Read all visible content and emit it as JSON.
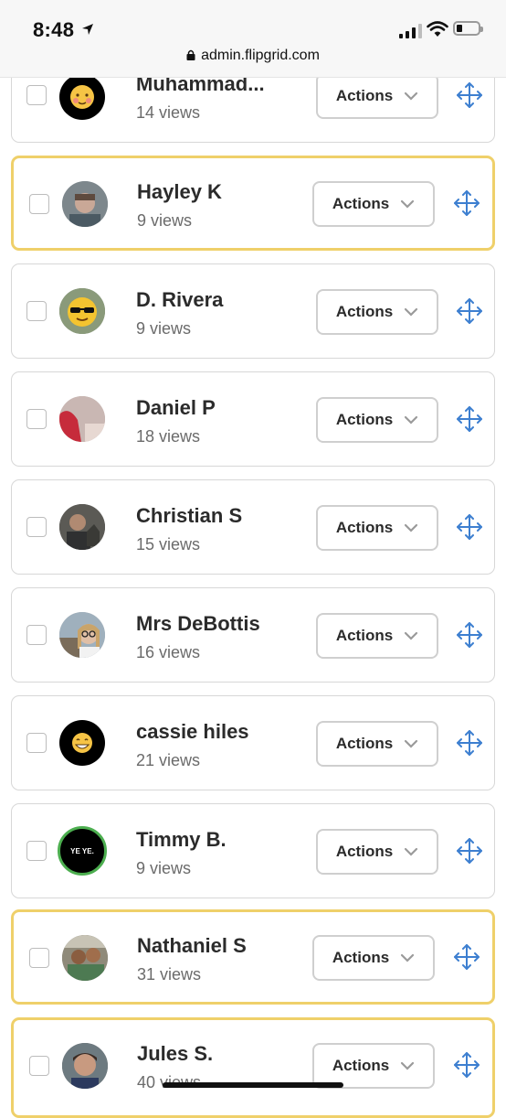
{
  "status_bar": {
    "time": "8:48",
    "url": "admin.flipgrid.com"
  },
  "action_label": "Actions",
  "responses": [
    {
      "name": "Muhammad...",
      "views": "14 views",
      "highlighted": false,
      "avatar": "emoji-cheeks"
    },
    {
      "name": "Hayley K",
      "views": "9 views",
      "highlighted": true,
      "avatar": "photo-gray"
    },
    {
      "name": "D. Rivera",
      "views": "9 views",
      "highlighted": false,
      "avatar": "emoji-sunglasses"
    },
    {
      "name": "Daniel P",
      "views": "18 views",
      "highlighted": false,
      "avatar": "photo-red"
    },
    {
      "name": "Christian S",
      "views": "15 views",
      "highlighted": false,
      "avatar": "photo-dark"
    },
    {
      "name": "Mrs DeBottis",
      "views": "16 views",
      "highlighted": false,
      "avatar": "photo-glasses"
    },
    {
      "name": "cassie hiles",
      "views": "21 views",
      "highlighted": false,
      "avatar": "emoji-grin"
    },
    {
      "name": "Timmy B.",
      "views": "9 views",
      "highlighted": false,
      "avatar": "yeye-badge",
      "avatar_text": "YE YE."
    },
    {
      "name": "Nathaniel S",
      "views": "31 views",
      "highlighted": true,
      "avatar": "photo-group"
    },
    {
      "name": "Jules S.",
      "views": "40 views",
      "highlighted": true,
      "avatar": "photo-boy"
    }
  ],
  "colors": {
    "highlight_border": "#efd06a",
    "move_icon": "#3d7fd0",
    "card_border": "#d7d7d7"
  }
}
